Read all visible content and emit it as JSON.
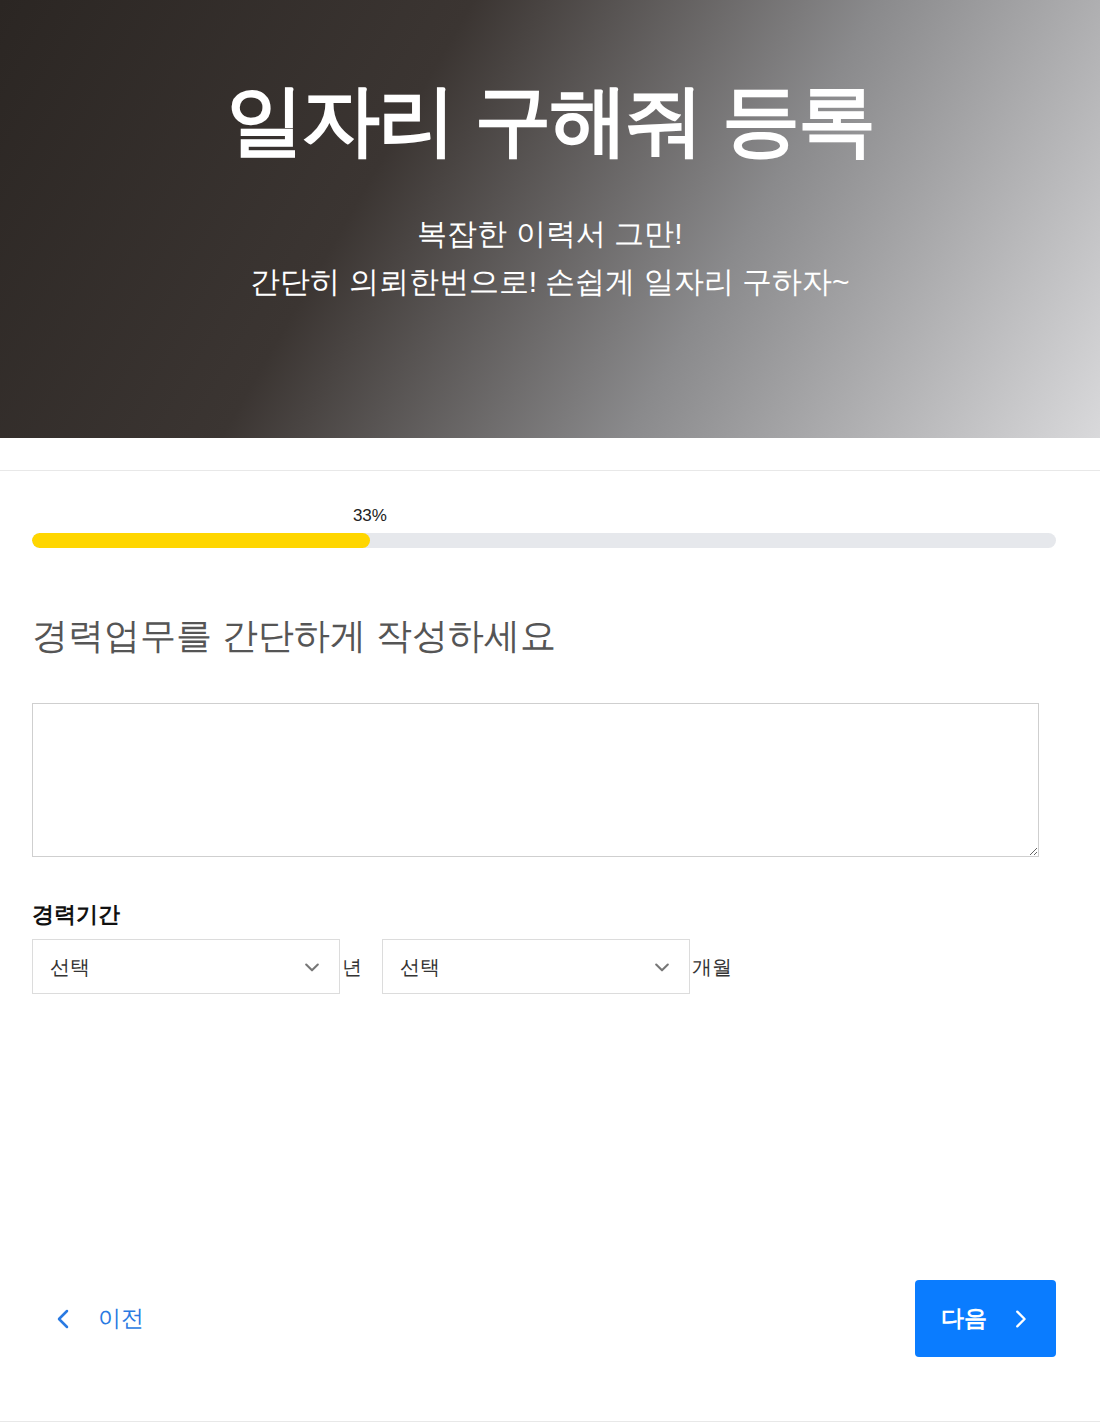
{
  "hero": {
    "title": "일자리 구해줘 등록",
    "subtitle": [
      "복잡한 이력서 그만!",
      "간단히 의뢰한번으로! 손쉽게 일자리 구하자~"
    ]
  },
  "progress": {
    "level": 0.33,
    "label": "33%"
  },
  "question": "경력업무를 간단하게 작성하세요",
  "textarea": {
    "value": ""
  },
  "career_period": {
    "label": "경력기간",
    "fields": [
      {
        "value": "선택",
        "unit": "년"
      },
      {
        "value": "선택",
        "unit": "개월"
      }
    ]
  },
  "nav": {
    "prev": "이전",
    "next": "다음"
  }
}
